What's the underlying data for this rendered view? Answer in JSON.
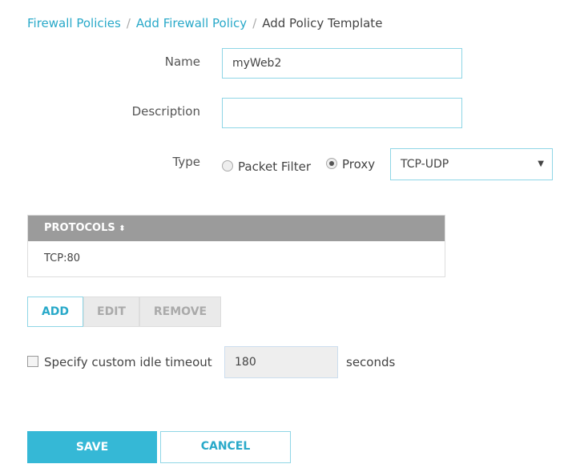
{
  "breadcrumb": {
    "items": [
      "Firewall Policies",
      "Add Firewall Policy"
    ],
    "current": "Add Policy Template",
    "separator": "/"
  },
  "form": {
    "name_label": "Name",
    "name_value": "myWeb2",
    "description_label": "Description",
    "description_value": "",
    "type_label": "Type",
    "type_options": [
      "Packet Filter",
      "Proxy"
    ],
    "type_selected": "Proxy",
    "proxy_select_value": "TCP-UDP"
  },
  "protocols": {
    "header": "PROTOCOLS",
    "rows": [
      "TCP:80"
    ],
    "add": "ADD",
    "edit": "EDIT",
    "remove": "REMOVE"
  },
  "timeout": {
    "label": "Specify custom idle timeout",
    "checked": false,
    "value": "180",
    "unit": "seconds"
  },
  "actions": {
    "save": "SAVE",
    "cancel": "CANCEL"
  },
  "colors": {
    "accent": "#29a9c9",
    "save_bg": "#35b8d6"
  }
}
